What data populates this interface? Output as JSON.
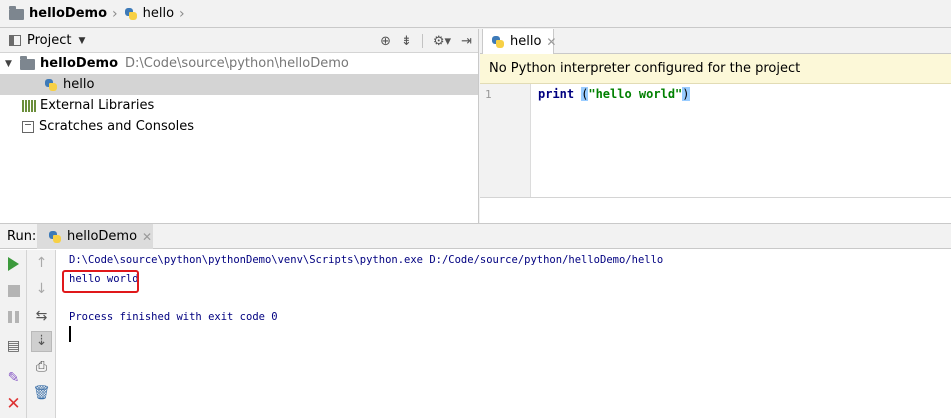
{
  "breadcrumb": {
    "project": "helloDemo",
    "file": "hello"
  },
  "project_panel": {
    "title": "Project",
    "tree": [
      {
        "label": "helloDemo",
        "path": "D:\\Code\\source\\python\\helloDemo"
      },
      {
        "label": "hello"
      },
      {
        "label": "External Libraries"
      },
      {
        "label": "Scratches and Consoles"
      }
    ]
  },
  "editor": {
    "tab_label": "hello",
    "banner": "No Python interpreter configured for the project",
    "line_number": "1",
    "code": {
      "keyword": "print",
      "open_paren": "(",
      "string": "\"hello world\"",
      "close_paren": ")"
    }
  },
  "run_panel": {
    "label": "Run:",
    "tab_label": "helloDemo",
    "console": [
      "D:\\Code\\source\\python\\pythonDemo\\venv\\Scripts\\python.exe D:/Code/source/python/helloDemo/hello",
      "hello world",
      "Process finished with exit code 0"
    ]
  },
  "colors": {
    "highlight_box": "#e0181a",
    "banner_bg": "#fcf8d8",
    "console_text": "#000080",
    "run_green": "#3c9a3c"
  }
}
